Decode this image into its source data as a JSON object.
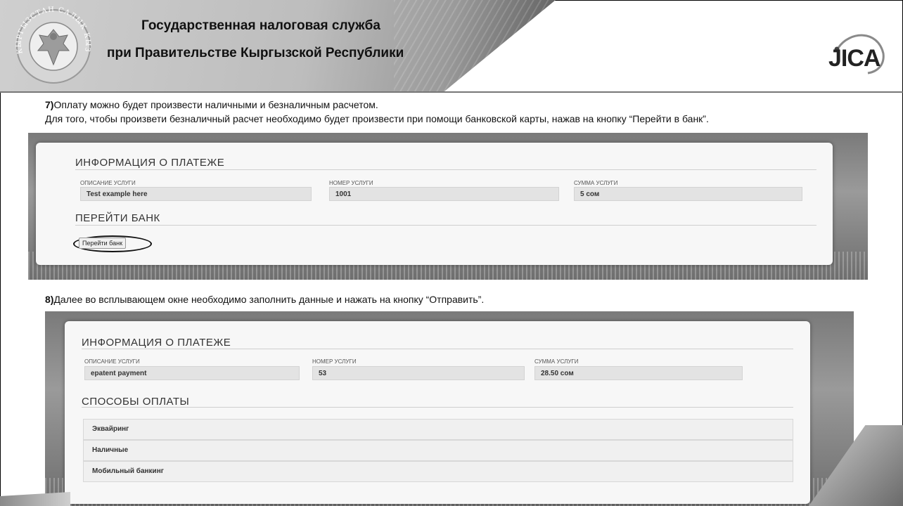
{
  "header": {
    "org_line1": "Государственная налоговая служба",
    "org_line2": "при Правительстве Кыргызской Республики",
    "emblem_text": "КЫРГЫЗСТАН САЛЫК КЫЗМАТЫ",
    "partner_logo": "JICA"
  },
  "step7": {
    "num": "7)",
    "line1": "Оплату можно будет произвести наличными и безналичным расчетом.",
    "line2": "Для того, чтобы произвети безналичный расчет необходимо будет произвести при помощи банковской карты, нажав на кнопку “Перейти в банк”."
  },
  "shot1": {
    "section_title": "ИНФОРМАЦИЯ О ПЛАТЕЖЕ",
    "fields": [
      {
        "label": "ОПИСАНИЕ УСЛУГИ",
        "value": "Test example here"
      },
      {
        "label": "НОМЕР УСЛУГИ",
        "value": "1001"
      },
      {
        "label": "СУММА УСЛУГИ",
        "value": "5 сом"
      }
    ],
    "bank_title": "ПЕРЕЙТИ БАНК",
    "bank_button": "Перейти банк"
  },
  "step8": {
    "num": "8)",
    "line1": "Далее во всплывающем окне необходимо заполнить данные и нажать на кнопку “Отправить”."
  },
  "shot2": {
    "section_title": "ИНФОРМАЦИЯ О ПЛАТЕЖЕ",
    "fields": [
      {
        "label": "ОПИСАНИЕ УСЛУГИ",
        "value": "epatent payment"
      },
      {
        "label": "НОМЕР УСЛУГИ",
        "value": "53"
      },
      {
        "label": "СУММА УСЛУГИ",
        "value": "28.50 сом"
      }
    ],
    "methods_title": "СПОСОБЫ ОПЛАТЫ",
    "methods": [
      "Эквайринг",
      "Наличные",
      "Мобильный банкинг"
    ]
  }
}
